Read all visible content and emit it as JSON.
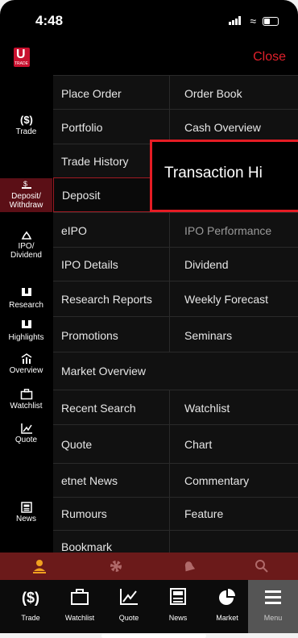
{
  "status": {
    "time": "4:48"
  },
  "header": {
    "logo_text": "U",
    "logo_sub": "TRADE",
    "close_label": "Close"
  },
  "categories": [
    {
      "label1": "Trade",
      "label2": ""
    },
    {
      "label1": "Deposit/",
      "label2": "Withdraw"
    },
    {
      "label1": "IPO/",
      "label2": "Dividend"
    },
    {
      "label1": "Research",
      "label2": ""
    },
    {
      "label1": "Highlights",
      "label2": ""
    },
    {
      "label1": "Overview",
      "label2": ""
    },
    {
      "label1": "Watchlist",
      "label2": ""
    },
    {
      "label1": "Quote",
      "label2": ""
    },
    {
      "label1": "News",
      "label2": ""
    }
  ],
  "rows": [
    [
      "Place Order",
      "Order Book"
    ],
    [
      "Portfolio",
      "Cash Overview"
    ],
    [
      "Trade History",
      ""
    ],
    [
      "Deposit",
      ""
    ],
    [
      "eIPO",
      "IPO Performance"
    ],
    [
      "IPO Details",
      "Dividend"
    ],
    [
      "Research Reports",
      "Weekly Forecast"
    ],
    [
      "Promotions",
      "Seminars"
    ],
    [
      "Market Overview",
      ""
    ],
    [
      "Recent Search",
      "Watchlist"
    ],
    [
      "Quote",
      "Chart"
    ],
    [
      "etnet News",
      "Commentary"
    ],
    [
      "Rumours",
      "Feature"
    ],
    [
      "Bookmark",
      ""
    ]
  ],
  "callout_text": "Transaction Hi",
  "bottom_nav": [
    "Trade",
    "Watchlist",
    "Quote",
    "News",
    "Market",
    "Menu"
  ],
  "colors": {
    "accent": "#e51c24",
    "orange": "#f0a020",
    "tab_red": "#6b1a1a"
  }
}
